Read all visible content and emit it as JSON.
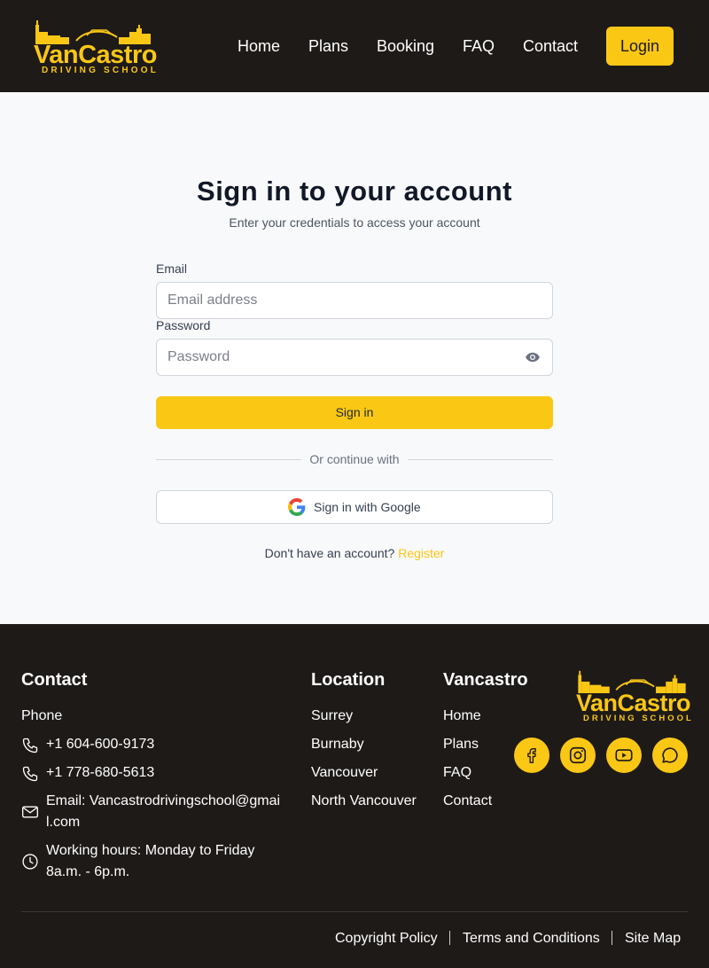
{
  "brand": {
    "name": "VanCastro",
    "tagline": "DRIVING SCHOOL",
    "accent": "#fac715",
    "dark": "#1e1a18"
  },
  "nav": {
    "items": [
      "Home",
      "Plans",
      "Booking",
      "FAQ",
      "Contact"
    ],
    "login_label": "Login"
  },
  "signin": {
    "title": "Sign in to your account",
    "subtitle": "Enter your credentials to access your account",
    "email_label": "Email",
    "email_placeholder": "Email address",
    "email_value": "",
    "password_label": "Password",
    "password_placeholder": "Password",
    "password_value": "",
    "submit_label": "Sign in",
    "divider_text": "Or continue with",
    "google_label": "Sign in with Google",
    "register_prompt": "Don't have an account?",
    "register_link": "Register"
  },
  "footer": {
    "contact": {
      "heading": "Contact",
      "phone_label": "Phone",
      "phone1": "+1 604-600-9173",
      "phone2": "+1 778-680-5613",
      "email_line1": "Email: Vancastrodrivingschool@gmai",
      "email_line2": "l.com",
      "hours_line1": "Working hours: Monday to Friday",
      "hours_line2": "8a.m. - 6p.m."
    },
    "location": {
      "heading": "Location",
      "items": [
        "Surrey",
        "Burnaby",
        "Vancouver",
        "North Vancouver"
      ]
    },
    "vancastro": {
      "heading": "Vancastro",
      "items": [
        "Home",
        "Plans",
        "FAQ",
        "Contact"
      ]
    },
    "social_icons": [
      "facebook-icon",
      "instagram-icon",
      "youtube-icon",
      "chat-icon"
    ],
    "bottom_links": [
      "Copyright Policy",
      "Terms and Conditions",
      "Site Map"
    ]
  }
}
